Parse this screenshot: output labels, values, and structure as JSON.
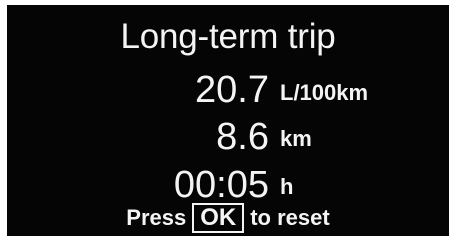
{
  "title": "Long-term trip",
  "consumption": {
    "value": "20.7",
    "unit": "L/100km"
  },
  "distance": {
    "value": "8.6",
    "unit": "km"
  },
  "time": {
    "value": "00:05",
    "unit": "h"
  },
  "footer": {
    "prefix": "Press",
    "button_label": "OK",
    "suffix": "to reset"
  },
  "colors": {
    "background": "#050505",
    "text": "#f4f4f4"
  }
}
